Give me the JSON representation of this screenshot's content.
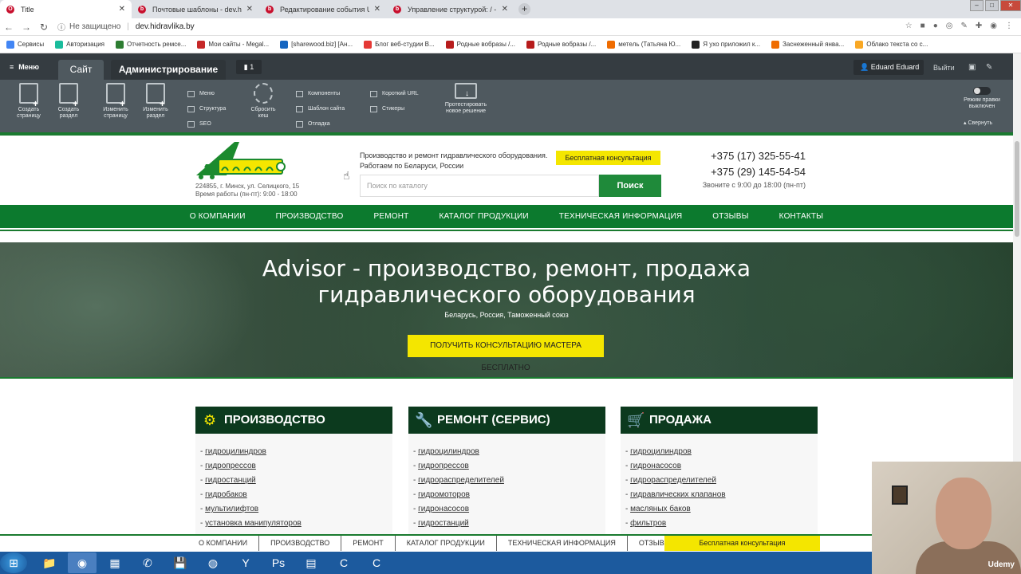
{
  "browser": {
    "tabs": [
      {
        "label": "Title",
        "icon": "opera-icon"
      },
      {
        "label": "Почтовые шаблоны - dev.hidravlika",
        "icon": "bitrix-icon"
      },
      {
        "label": "Редактирование события USER",
        "icon": "bitrix-icon"
      },
      {
        "label": "Управление структурой: / - dev",
        "icon": "bitrix-icon"
      }
    ],
    "security": "Не защищено",
    "url": "dev.hidravlika.by",
    "bookmarks": [
      {
        "label": "Сервисы",
        "color": "#4285f4"
      },
      {
        "label": "Авторизация",
        "color": "#1abc9c"
      },
      {
        "label": "Отчетность ремсе...",
        "color": "#2e7d32"
      },
      {
        "label": "Мои сайты - Megal...",
        "color": "#c62828"
      },
      {
        "label": "[sharewood.biz] [Ан...",
        "color": "#1565c0"
      },
      {
        "label": "Блог веб-студии В...",
        "color": "#e53935"
      },
      {
        "label": "Родные вобразы /...",
        "color": "#b71c1c"
      },
      {
        "label": "Родные вобразы /...",
        "color": "#b71c1c"
      },
      {
        "label": "метель (Татьяна Ю...",
        "color": "#ef6c00"
      },
      {
        "label": "Я ухо приложил к...",
        "color": "#222222"
      },
      {
        "label": "Заснеженный янва...",
        "color": "#ef6c00"
      },
      {
        "label": "Облако текста со с...",
        "color": "#f9a825"
      }
    ]
  },
  "admin": {
    "menu": "Меню",
    "tab_site": "Сайт",
    "tab_admin": "Администрирование",
    "notifications": "1",
    "user": "Eduard Eduard",
    "logout": "Выйти",
    "tools": [
      {
        "l1": "Создать",
        "l2": "страницу"
      },
      {
        "l1": "Создать",
        "l2": "раздел"
      },
      {
        "l1": "Изменить",
        "l2": "страницу"
      },
      {
        "l1": "Изменить",
        "l2": "раздел"
      }
    ],
    "col1": [
      "Меню",
      "Структура",
      "SEO"
    ],
    "reset": {
      "l1": "Сбросить",
      "l2": "кеш"
    },
    "col2": [
      "Компоненты",
      "Шаблон сайта",
      "Отладка"
    ],
    "col3": [
      "Короткий URL",
      "Стикеры"
    ],
    "test": {
      "l1": "Протестировать",
      "l2": "новое решение"
    },
    "edit_mode": {
      "l1": "Режим правки",
      "l2": "выключен"
    },
    "collapse": "Свернуть"
  },
  "site": {
    "address": "224855, г. Минск, ул. Селицкого, 15",
    "work_hours": "Время работы (пн-пт): 9:00 - 18:00",
    "desc1": "Производство и ремонт гидравлического оборудования.",
    "desc2": "Работаем по Беларуси, России",
    "consult": "Бесплатная консультация",
    "search_placeholder": "Поиск по каталогу",
    "search_btn": "Поиск",
    "phone1": "+375 (17) 325-55-41",
    "phone2": "+375 (29) 145-54-54",
    "call_hours": "Звоните с 9:00 до 18:00 (пн-пт)",
    "nav": [
      "О КОМПАНИИ",
      "ПРОИЗВОДСТВО",
      "РЕМОНТ",
      "КАТАЛОГ ПРОДУКЦИИ",
      "ТЕХНИЧЕСКАЯ ИНФОРМАЦИЯ",
      "ОТЗЫВЫ",
      "КОНТАКТЫ"
    ],
    "hero_title1": "Advisor - производство, ремонт, продажа",
    "hero_title2": "гидравлического оборудования",
    "hero_sub": "Беларусь, Россия, Таможенный союз",
    "hero_btn": "ПОЛУЧИТЬ КОНСУЛЬТАЦИЮ МАСТЕРА БЕСПЛАТНО",
    "cards": [
      {
        "title": "ПРОИЗВОДСТВО",
        "icon": "gear-icon",
        "items": [
          "гидроцилиндров",
          "гидропрессов",
          "гидростанций",
          "гидробаков",
          "мультилифтов",
          "установка манипуляторов"
        ]
      },
      {
        "title": "РЕМОНТ (СЕРВИС)",
        "icon": "wrench-icon",
        "items": [
          "гидроцилиндров",
          "гидропрессов",
          "гидрораспределителей",
          "гидромоторов",
          "гидронасосов",
          "гидростанций"
        ]
      },
      {
        "title": "ПРОДАЖА",
        "icon": "cart-icon",
        "items": [
          "гидроцилиндров",
          "гидронасосов",
          "гидрораспределителей",
          "гидравлических клапанов",
          "масляных баков",
          "фильтров"
        ]
      }
    ],
    "footer_consult": "Бесплатная консультация"
  },
  "webcam_brand": "Udemy"
}
